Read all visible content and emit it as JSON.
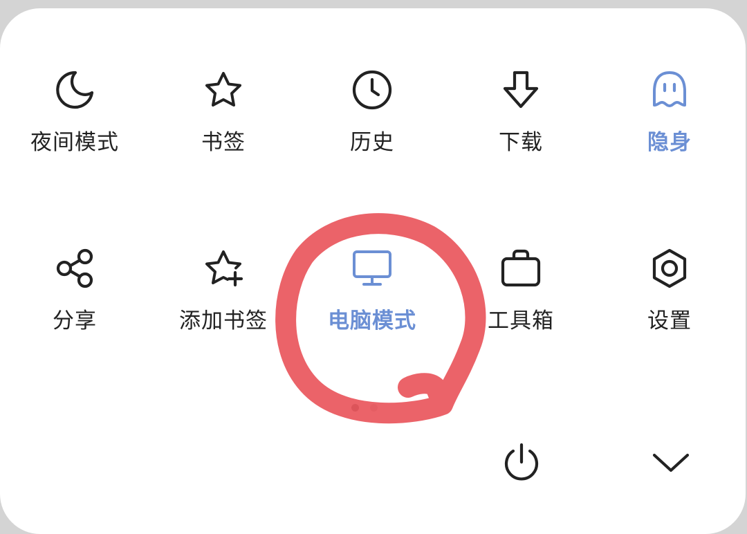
{
  "menu": {
    "row1": [
      {
        "id": "night-mode",
        "label": "夜间模式",
        "icon": "moon-icon"
      },
      {
        "id": "bookmarks",
        "label": "书签",
        "icon": "star-icon"
      },
      {
        "id": "history",
        "label": "历史",
        "icon": "clock-icon"
      },
      {
        "id": "downloads",
        "label": "下载",
        "icon": "download-arrow-icon"
      },
      {
        "id": "incognito",
        "label": "隐身",
        "icon": "ghost-icon",
        "active": true
      }
    ],
    "row2": [
      {
        "id": "share",
        "label": "分享",
        "icon": "share-icon"
      },
      {
        "id": "add-bookmark",
        "label": "添加书签",
        "icon": "star-plus-icon"
      },
      {
        "id": "desktop-mode",
        "label": "电脑模式",
        "icon": "monitor-icon",
        "active": true
      },
      {
        "id": "toolbox",
        "label": "工具箱",
        "icon": "briefcase-icon"
      },
      {
        "id": "settings",
        "label": "设置",
        "icon": "hexagon-gear-icon"
      }
    ]
  },
  "pager": {
    "pages": 2,
    "current": 1
  },
  "bottom": {
    "power_icon": "power-icon",
    "collapse_icon": "chevron-down-icon"
  },
  "colors": {
    "active": "#6b8fd4",
    "text": "#222222",
    "annotation": "#e8484f",
    "panel": "#ffffff",
    "dot_active": "#9a9a9a",
    "dot_inactive": "#d6d6d6"
  }
}
